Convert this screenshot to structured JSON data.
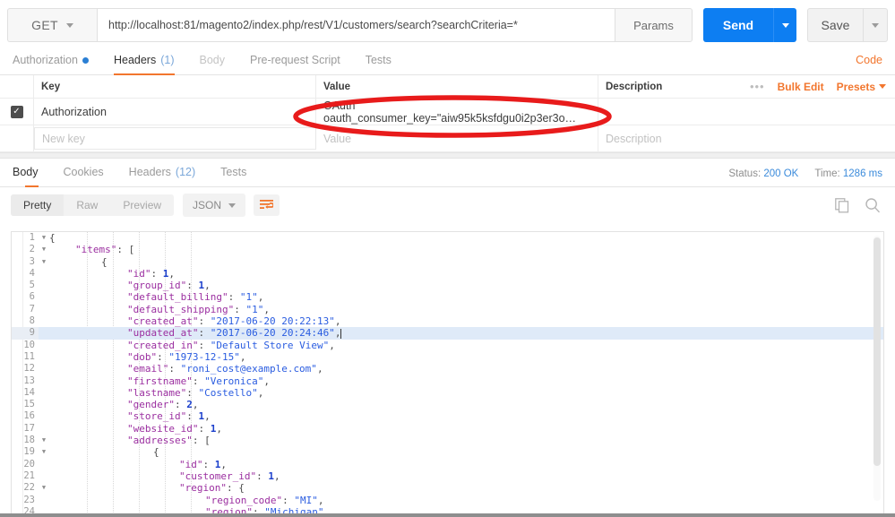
{
  "request_bar": {
    "method": "GET",
    "url": "http://localhost:81/magento2/index.php/rest/V1/customers/search?searchCriteria=*",
    "params_label": "Params",
    "send_label": "Send",
    "save_label": "Save"
  },
  "request_tabs": {
    "items": [
      {
        "label": "Authorization",
        "state": "normal",
        "dot": true
      },
      {
        "label": "Headers",
        "count": "(1)",
        "state": "active"
      },
      {
        "label": "Body",
        "state": "dim"
      },
      {
        "label": "Pre-request Script",
        "state": "normal"
      },
      {
        "label": "Tests",
        "state": "normal"
      }
    ],
    "code_link": "Code"
  },
  "headers_table": {
    "columns": [
      "Key",
      "Value",
      "Description"
    ],
    "actions": {
      "more": "•••",
      "bulk_edit": "Bulk Edit",
      "presets": "Presets"
    },
    "rows": [
      {
        "checked": true,
        "key": "Authorization",
        "value": "OAuth oauth_consumer_key=\"aiw95k5ksfdgu0i2p3er3o…",
        "description": ""
      }
    ],
    "new_row": {
      "key_placeholder": "New key",
      "value_placeholder": "Value",
      "description_placeholder": "Description"
    }
  },
  "response_tabs": {
    "items": [
      {
        "label": "Body",
        "state": "active"
      },
      {
        "label": "Cookies",
        "state": "normal"
      },
      {
        "label": "Headers",
        "count": "(12)",
        "state": "normal"
      },
      {
        "label": "Tests",
        "state": "normal"
      }
    ],
    "status_label": "Status:",
    "status_value": "200 OK",
    "time_label": "Time:",
    "time_value": "1286 ms"
  },
  "body_toolbar": {
    "view_modes": [
      {
        "label": "Pretty",
        "active": true
      },
      {
        "label": "Raw",
        "active": false
      },
      {
        "label": "Preview",
        "active": false
      }
    ],
    "format": "JSON",
    "wrap_icon": "word-wrap-icon",
    "copy_icon": "copy-icon",
    "search_icon": "search-icon"
  },
  "colors": {
    "accent_orange": "#f2762e",
    "send_blue": "#0d7ef2",
    "status_blue": "#3b8bdb",
    "annotation_red": "#e81b1b"
  },
  "response_body": {
    "active_line": 9,
    "lines": [
      {
        "n": 1,
        "fold": true,
        "indent": 0,
        "tokens": [
          {
            "t": "{",
            "c": "p"
          }
        ]
      },
      {
        "n": 2,
        "fold": true,
        "indent": 1,
        "tokens": [
          {
            "t": "\"items\"",
            "c": "key"
          },
          {
            "t": ": [",
            "c": "p"
          }
        ]
      },
      {
        "n": 3,
        "fold": true,
        "indent": 2,
        "tokens": [
          {
            "t": "{",
            "c": "p"
          }
        ]
      },
      {
        "n": 4,
        "fold": false,
        "indent": 3,
        "tokens": [
          {
            "t": "\"id\"",
            "c": "key"
          },
          {
            "t": ": ",
            "c": "p"
          },
          {
            "t": "1",
            "c": "num"
          },
          {
            "t": ",",
            "c": "p"
          }
        ]
      },
      {
        "n": 5,
        "fold": false,
        "indent": 3,
        "tokens": [
          {
            "t": "\"group_id\"",
            "c": "key"
          },
          {
            "t": ": ",
            "c": "p"
          },
          {
            "t": "1",
            "c": "num"
          },
          {
            "t": ",",
            "c": "p"
          }
        ]
      },
      {
        "n": 6,
        "fold": false,
        "indent": 3,
        "tokens": [
          {
            "t": "\"default_billing\"",
            "c": "key"
          },
          {
            "t": ": ",
            "c": "p"
          },
          {
            "t": "\"1\"",
            "c": "str"
          },
          {
            "t": ",",
            "c": "p"
          }
        ]
      },
      {
        "n": 7,
        "fold": false,
        "indent": 3,
        "tokens": [
          {
            "t": "\"default_shipping\"",
            "c": "key"
          },
          {
            "t": ": ",
            "c": "p"
          },
          {
            "t": "\"1\"",
            "c": "str"
          },
          {
            "t": ",",
            "c": "p"
          }
        ]
      },
      {
        "n": 8,
        "fold": false,
        "indent": 3,
        "tokens": [
          {
            "t": "\"created_at\"",
            "c": "key"
          },
          {
            "t": ": ",
            "c": "p"
          },
          {
            "t": "\"2017-06-20 20:22:13\"",
            "c": "str"
          },
          {
            "t": ",",
            "c": "p"
          }
        ]
      },
      {
        "n": 9,
        "fold": false,
        "indent": 3,
        "tokens": [
          {
            "t": "\"updated_at\"",
            "c": "key"
          },
          {
            "t": ": ",
            "c": "p"
          },
          {
            "t": "\"2017-06-20 20:24:46\"",
            "c": "str"
          },
          {
            "t": ",",
            "c": "p"
          }
        ]
      },
      {
        "n": 10,
        "fold": false,
        "indent": 3,
        "tokens": [
          {
            "t": "\"created_in\"",
            "c": "key"
          },
          {
            "t": ": ",
            "c": "p"
          },
          {
            "t": "\"Default Store View\"",
            "c": "str"
          },
          {
            "t": ",",
            "c": "p"
          }
        ]
      },
      {
        "n": 11,
        "fold": false,
        "indent": 3,
        "tokens": [
          {
            "t": "\"dob\"",
            "c": "key"
          },
          {
            "t": ": ",
            "c": "p"
          },
          {
            "t": "\"1973-12-15\"",
            "c": "str"
          },
          {
            "t": ",",
            "c": "p"
          }
        ]
      },
      {
        "n": 12,
        "fold": false,
        "indent": 3,
        "tokens": [
          {
            "t": "\"email\"",
            "c": "key"
          },
          {
            "t": ": ",
            "c": "p"
          },
          {
            "t": "\"roni_cost@example.com\"",
            "c": "str"
          },
          {
            "t": ",",
            "c": "p"
          }
        ]
      },
      {
        "n": 13,
        "fold": false,
        "indent": 3,
        "tokens": [
          {
            "t": "\"firstname\"",
            "c": "key"
          },
          {
            "t": ": ",
            "c": "p"
          },
          {
            "t": "\"Veronica\"",
            "c": "str"
          },
          {
            "t": ",",
            "c": "p"
          }
        ]
      },
      {
        "n": 14,
        "fold": false,
        "indent": 3,
        "tokens": [
          {
            "t": "\"lastname\"",
            "c": "key"
          },
          {
            "t": ": ",
            "c": "p"
          },
          {
            "t": "\"Costello\"",
            "c": "str"
          },
          {
            "t": ",",
            "c": "p"
          }
        ]
      },
      {
        "n": 15,
        "fold": false,
        "indent": 3,
        "tokens": [
          {
            "t": "\"gender\"",
            "c": "key"
          },
          {
            "t": ": ",
            "c": "p"
          },
          {
            "t": "2",
            "c": "num"
          },
          {
            "t": ",",
            "c": "p"
          }
        ]
      },
      {
        "n": 16,
        "fold": false,
        "indent": 3,
        "tokens": [
          {
            "t": "\"store_id\"",
            "c": "key"
          },
          {
            "t": ": ",
            "c": "p"
          },
          {
            "t": "1",
            "c": "num"
          },
          {
            "t": ",",
            "c": "p"
          }
        ]
      },
      {
        "n": 17,
        "fold": false,
        "indent": 3,
        "tokens": [
          {
            "t": "\"website_id\"",
            "c": "key"
          },
          {
            "t": ": ",
            "c": "p"
          },
          {
            "t": "1",
            "c": "num"
          },
          {
            "t": ",",
            "c": "p"
          }
        ]
      },
      {
        "n": 18,
        "fold": true,
        "indent": 3,
        "tokens": [
          {
            "t": "\"addresses\"",
            "c": "key"
          },
          {
            "t": ": [",
            "c": "p"
          }
        ]
      },
      {
        "n": 19,
        "fold": true,
        "indent": 4,
        "tokens": [
          {
            "t": "{",
            "c": "p"
          }
        ]
      },
      {
        "n": 20,
        "fold": false,
        "indent": 5,
        "tokens": [
          {
            "t": "\"id\"",
            "c": "key"
          },
          {
            "t": ": ",
            "c": "p"
          },
          {
            "t": "1",
            "c": "num"
          },
          {
            "t": ",",
            "c": "p"
          }
        ]
      },
      {
        "n": 21,
        "fold": false,
        "indent": 5,
        "tokens": [
          {
            "t": "\"customer_id\"",
            "c": "key"
          },
          {
            "t": ": ",
            "c": "p"
          },
          {
            "t": "1",
            "c": "num"
          },
          {
            "t": ",",
            "c": "p"
          }
        ]
      },
      {
        "n": 22,
        "fold": true,
        "indent": 5,
        "tokens": [
          {
            "t": "\"region\"",
            "c": "key"
          },
          {
            "t": ": {",
            "c": "p"
          }
        ]
      },
      {
        "n": 23,
        "fold": false,
        "indent": 6,
        "tokens": [
          {
            "t": "\"region_code\"",
            "c": "key"
          },
          {
            "t": ": ",
            "c": "p"
          },
          {
            "t": "\"MI\"",
            "c": "str"
          },
          {
            "t": ",",
            "c": "p"
          }
        ]
      },
      {
        "n": 24,
        "fold": false,
        "indent": 6,
        "tokens": [
          {
            "t": "\"region\"",
            "c": "key"
          },
          {
            "t": ": ",
            "c": "p"
          },
          {
            "t": "\"Michigan\"",
            "c": "str"
          },
          {
            "t": ",",
            "c": "p"
          }
        ]
      }
    ]
  }
}
